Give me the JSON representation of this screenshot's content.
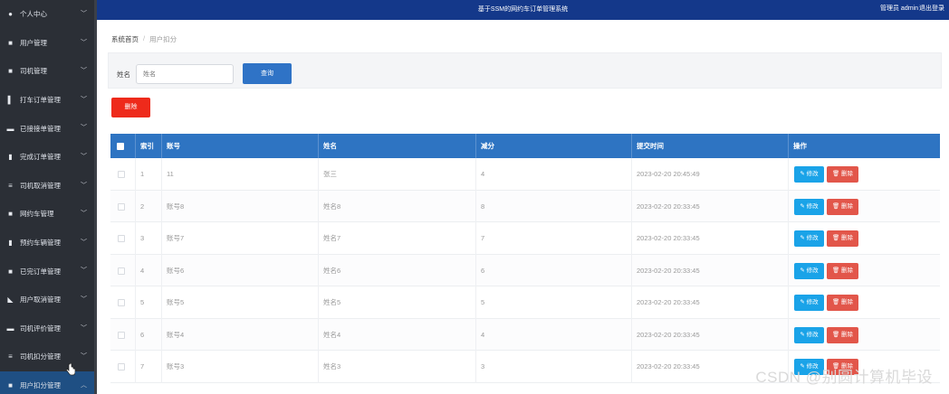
{
  "topbar": {
    "title": "基于SSM的网约车订单管理系统",
    "user": "管理员 admin",
    "logout": "退出登录"
  },
  "sidebar": {
    "items": [
      {
        "label": "个人中心",
        "icon": "person-icon",
        "glyph": "●"
      },
      {
        "label": "用户管理",
        "icon": "grid-icon",
        "glyph": "■"
      },
      {
        "label": "司机管理",
        "icon": "grid-icon",
        "glyph": "■"
      },
      {
        "label": "打车订单管理",
        "icon": "bar-chart-icon",
        "glyph": "▌"
      },
      {
        "label": "已接接单管理",
        "icon": "chat-icon",
        "glyph": "▬"
      },
      {
        "label": "完成订单管理",
        "icon": "document-icon",
        "glyph": "▮"
      },
      {
        "label": "司机取消管理",
        "icon": "list-icon",
        "glyph": "≡"
      },
      {
        "label": "网约车管理",
        "icon": "grid-icon",
        "glyph": "■"
      },
      {
        "label": "预约车辆管理",
        "icon": "clipboard-icon",
        "glyph": "▮"
      },
      {
        "label": "已完订单管理",
        "icon": "grid-icon",
        "glyph": "■"
      },
      {
        "label": "用户取消管理",
        "icon": "thumb-icon",
        "glyph": "◣"
      },
      {
        "label": "司机评价管理",
        "icon": "ticket-icon",
        "glyph": "▬"
      },
      {
        "label": "司机扣分管理",
        "icon": "menu-icon",
        "glyph": "≡"
      },
      {
        "label": "用户扣分管理",
        "icon": "grid-icon",
        "glyph": "■"
      }
    ],
    "active_index": 13
  },
  "breadcrumb": {
    "home": "系统首页",
    "separator": "/",
    "current": "用户扣分"
  },
  "search": {
    "label": "姓名",
    "placeholder": "姓名",
    "button": "查询"
  },
  "delete_button": "删除",
  "table": {
    "headers": [
      "索引",
      "账号",
      "姓名",
      "减分",
      "提交时间",
      "操作"
    ],
    "edit_label": "✎ 修改",
    "delete_label": "🗑 删除",
    "rows": [
      {
        "index": "1",
        "account": "11",
        "name": "张三",
        "deduct": "4",
        "time": "2023-02-20 20:45:49"
      },
      {
        "index": "2",
        "account": "账号8",
        "name": "姓名8",
        "deduct": "8",
        "time": "2023-02-20 20:33:45"
      },
      {
        "index": "3",
        "account": "账号7",
        "name": "姓名7",
        "deduct": "7",
        "time": "2023-02-20 20:33:45"
      },
      {
        "index": "4",
        "account": "账号6",
        "name": "姓名6",
        "deduct": "6",
        "time": "2023-02-20 20:33:45"
      },
      {
        "index": "5",
        "account": "账号5",
        "name": "姓名5",
        "deduct": "5",
        "time": "2023-02-20 20:33:45"
      },
      {
        "index": "6",
        "account": "账号4",
        "name": "姓名4",
        "deduct": "4",
        "time": "2023-02-20 20:33:45"
      },
      {
        "index": "7",
        "account": "账号3",
        "name": "姓名3",
        "deduct": "3",
        "time": "2023-02-20 20:33:45"
      }
    ]
  },
  "watermark": "CSDN @别圆计算机毕设",
  "colors": {
    "sidebar_bg": "#2b2f36",
    "topbar_bg": "#14388a",
    "table_header_bg": "#2e74c2",
    "search_button": "#2f73c6",
    "delete_button": "#ee2a1b",
    "edit_button": "#1aa3e8",
    "row_delete_button": "#e2564a"
  }
}
